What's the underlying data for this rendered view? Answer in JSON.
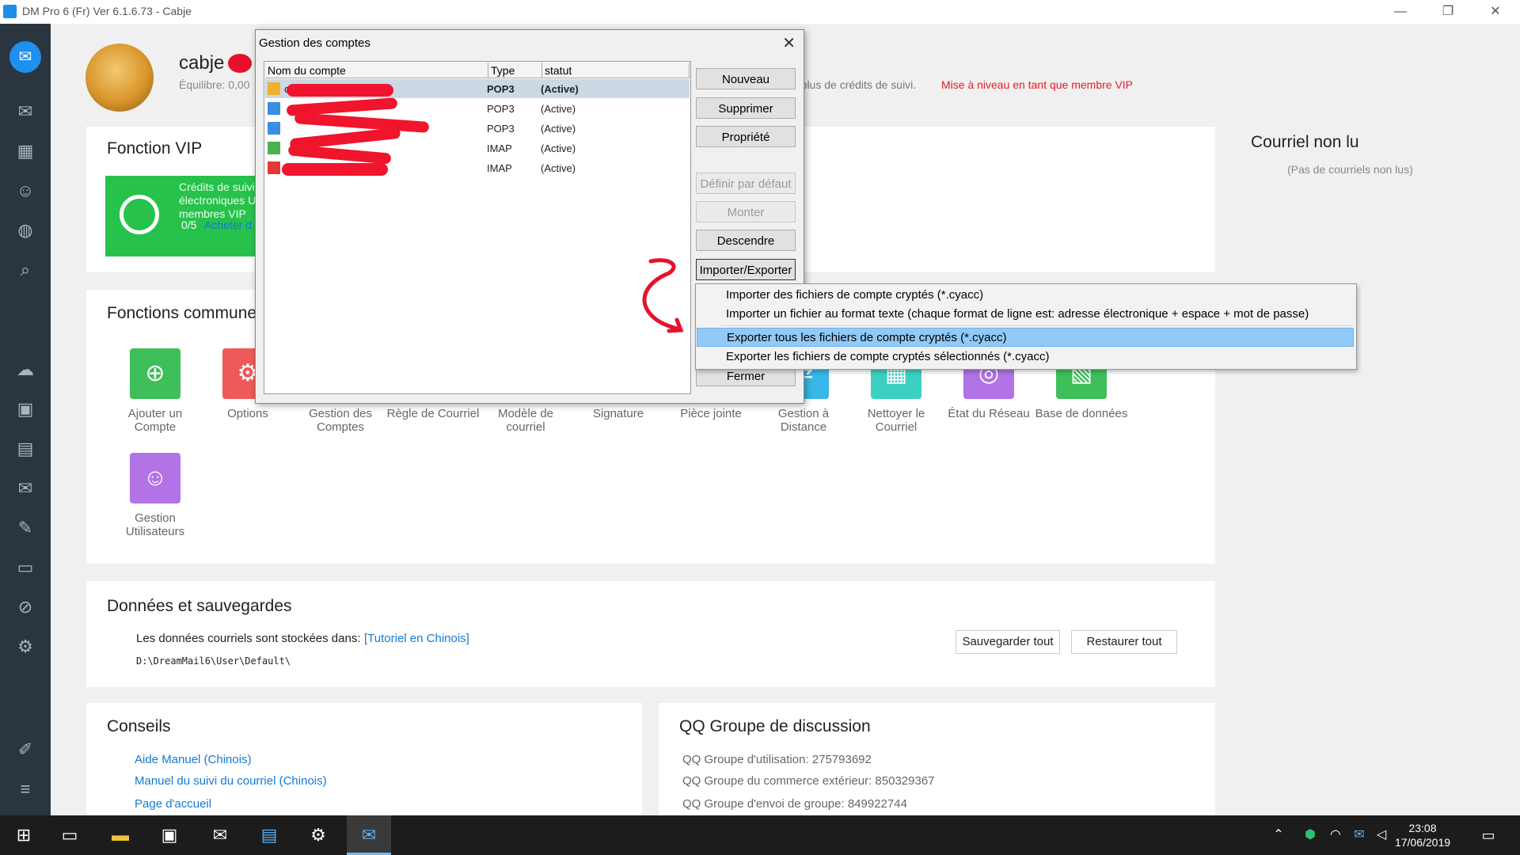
{
  "window": {
    "title": "DM Pro 6 (Fr) Ver 6.1.6.73  -  Cabje",
    "minimize": "—",
    "restore": "❐",
    "close": "✕"
  },
  "sidebar": {
    "logo_icon": "mail-logo-icon",
    "items": [
      "mail-icon",
      "calendar-icon",
      "contacts-icon",
      "globe-icon",
      "search-icon",
      "cloud-icon",
      "calendar-30-icon",
      "contact-card-icon",
      "send-mail-icon",
      "pen-icon",
      "document-icon",
      "attachment-icon",
      "settings-icon",
      "wrench-icon",
      "menu-icon"
    ]
  },
  "header": {
    "username": "cabje",
    "balance": "Équilibre:  0,00",
    "credits_text": "ir plus de crédits de suivi.",
    "vip_upgrade": "Mise à niveau en tant que membre VIP"
  },
  "vip": {
    "title": "Fonction VIP",
    "text": "Crédits de suivi électroniques U membres VIP",
    "count": "0/5",
    "buy": "Acheter d"
  },
  "unread": {
    "title": "Courriel non lu",
    "empty": "(Pas de courriels non lus)"
  },
  "functions": {
    "title": "Fonctions commune",
    "items": [
      {
        "label": "Ajouter un Compte",
        "icon": "add-account-icon",
        "color": "#3fbf5a"
      },
      {
        "label": "Options",
        "icon": "gear-icon",
        "color": "#f0595a"
      },
      {
        "label": "Gestion des Comptes",
        "icon": "accounts-icon",
        "color": "#4a9de8"
      },
      {
        "label": "Règle de Courriel",
        "icon": "rule-icon",
        "color": "#f0a830"
      },
      {
        "label": "Modèle de courriel",
        "icon": "template-icon",
        "color": "#3fbf5a"
      },
      {
        "label": "Signature",
        "icon": "signature-icon",
        "color": "#4a9de8"
      },
      {
        "label": "Pièce jointe",
        "icon": "attachment-icon",
        "color": "#f0a830"
      },
      {
        "label": "Gestion à Distance",
        "icon": "remote-icon",
        "color": "#38b8e8"
      },
      {
        "label": "Nettoyer le Courriel",
        "icon": "clean-icon",
        "color": "#3cd0c0"
      },
      {
        "label": "État du Réseau",
        "icon": "network-icon",
        "color": "#b173e6"
      },
      {
        "label": "Base de données",
        "icon": "database-icon",
        "color": "#3fbf5a"
      },
      {
        "label": "Gestion Utilisateurs",
        "icon": "users-icon",
        "color": "#b173e6"
      }
    ]
  },
  "data": {
    "title": "Données et sauvegardes",
    "stored_label": "Les données courriels sont stockées dans:",
    "tutorial_link": "[Tutoriel en Chinois]",
    "path": "D:\\DreamMail6\\User\\Default\\",
    "save_all": "Sauvegarder tout",
    "restore_all": "Restaurer tout"
  },
  "tips": {
    "title": "Conseils",
    "links": [
      "Aide Manuel (Chinois)",
      "Manuel du suivi du courriel (Chinois)",
      "Page d'accueil"
    ]
  },
  "qq": {
    "title": "QQ Groupe de discussion",
    "lines": [
      "QQ Groupe d'utilisation: 275793692",
      "QQ Groupe du commerce extérieur: 850329367",
      "QQ Groupe d'envoi de groupe: 849922744"
    ]
  },
  "dialog": {
    "title": "Gestion des comptes",
    "close": "✕",
    "columns": [
      "Nom du compte",
      "Type",
      "statut"
    ],
    "rows": [
      {
        "name": "c",
        "type": "POP3",
        "status": "(Active)",
        "icon": "folder-account-icon",
        "selected": true
      },
      {
        "name": "",
        "type": "POP3",
        "status": "(Active)",
        "icon": "user-account-icon",
        "selected": false
      },
      {
        "name": "",
        "type": "POP3",
        "status": "(Active)",
        "icon": "user-account-icon",
        "selected": false
      },
      {
        "name": "",
        "type": "IMAP",
        "status": "(Active)",
        "icon": "google-account-icon",
        "selected": false
      },
      {
        "name": "",
        "type": "IMAP",
        "status": "(Active)",
        "icon": "gmail-icon",
        "selected": false
      }
    ],
    "buttons": {
      "new": "Nouveau",
      "delete": "Supprimer",
      "property": "Propriété",
      "set_default": "Définir par défaut",
      "up": "Monter",
      "down": "Descendre",
      "import_export": "Importer/Exporter",
      "close": "Fermer"
    }
  },
  "context_menu": {
    "items": [
      "Importer des fichiers de compte cryptés (*.cyacc)",
      "Importer un fichier au format texte (chaque format de ligne est: adresse électronique + espace + mot de passe)",
      "Exporter tous les fichiers de compte cryptés (*.cyacc)",
      "Exporter les fichiers de compte cryptés sélectionnés (*.cyacc)"
    ],
    "highlighted_index": 2
  },
  "taskbar": {
    "time": "23:08",
    "date": "17/06/2019",
    "icons": [
      "start-icon",
      "task-view-icon",
      "file-explorer-icon",
      "store-icon",
      "mail-app-icon",
      "contact-app-icon",
      "settings-icon",
      "dreammail-icon"
    ]
  }
}
